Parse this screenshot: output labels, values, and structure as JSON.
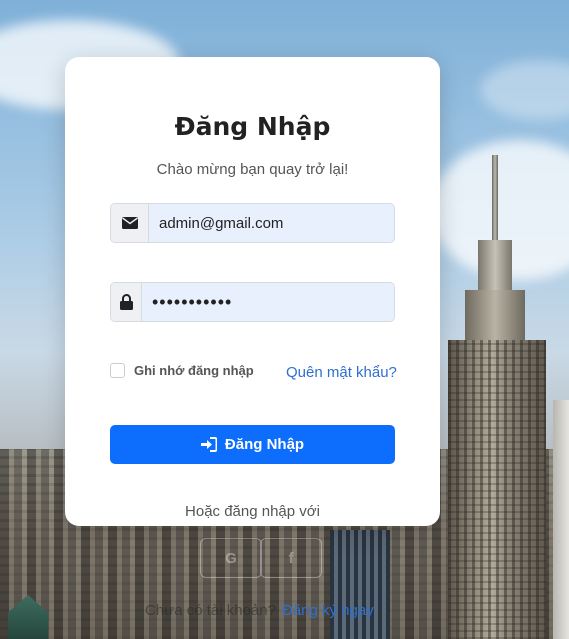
{
  "login": {
    "title": "Đăng Nhập",
    "subtitle": "Chào mừng bạn quay trở lại!",
    "email_value": "admin@gmail.com",
    "email_icon": "envelope-icon",
    "password_value": "•••••••••••",
    "password_icon": "lock-icon",
    "remember_label": "Ghi nhớ đăng nhập",
    "remember_checked": false,
    "forgot_link": "Quên mật khẩu?",
    "submit_label": "Đăng Nhập",
    "submit_icon": "sign-in-icon",
    "or_text": "Hoặc đăng nhập với",
    "social": [
      {
        "icon": "google-icon",
        "glyph": "G"
      },
      {
        "icon": "facebook-icon",
        "glyph": "f"
      }
    ],
    "signup_text": "Chưa có tài khoản?",
    "signup_link": "Đăng ký ngay"
  },
  "colors": {
    "primary": "#0d6efd",
    "link": "#2f6fd0",
    "input_bg": "#e8f0fe"
  }
}
